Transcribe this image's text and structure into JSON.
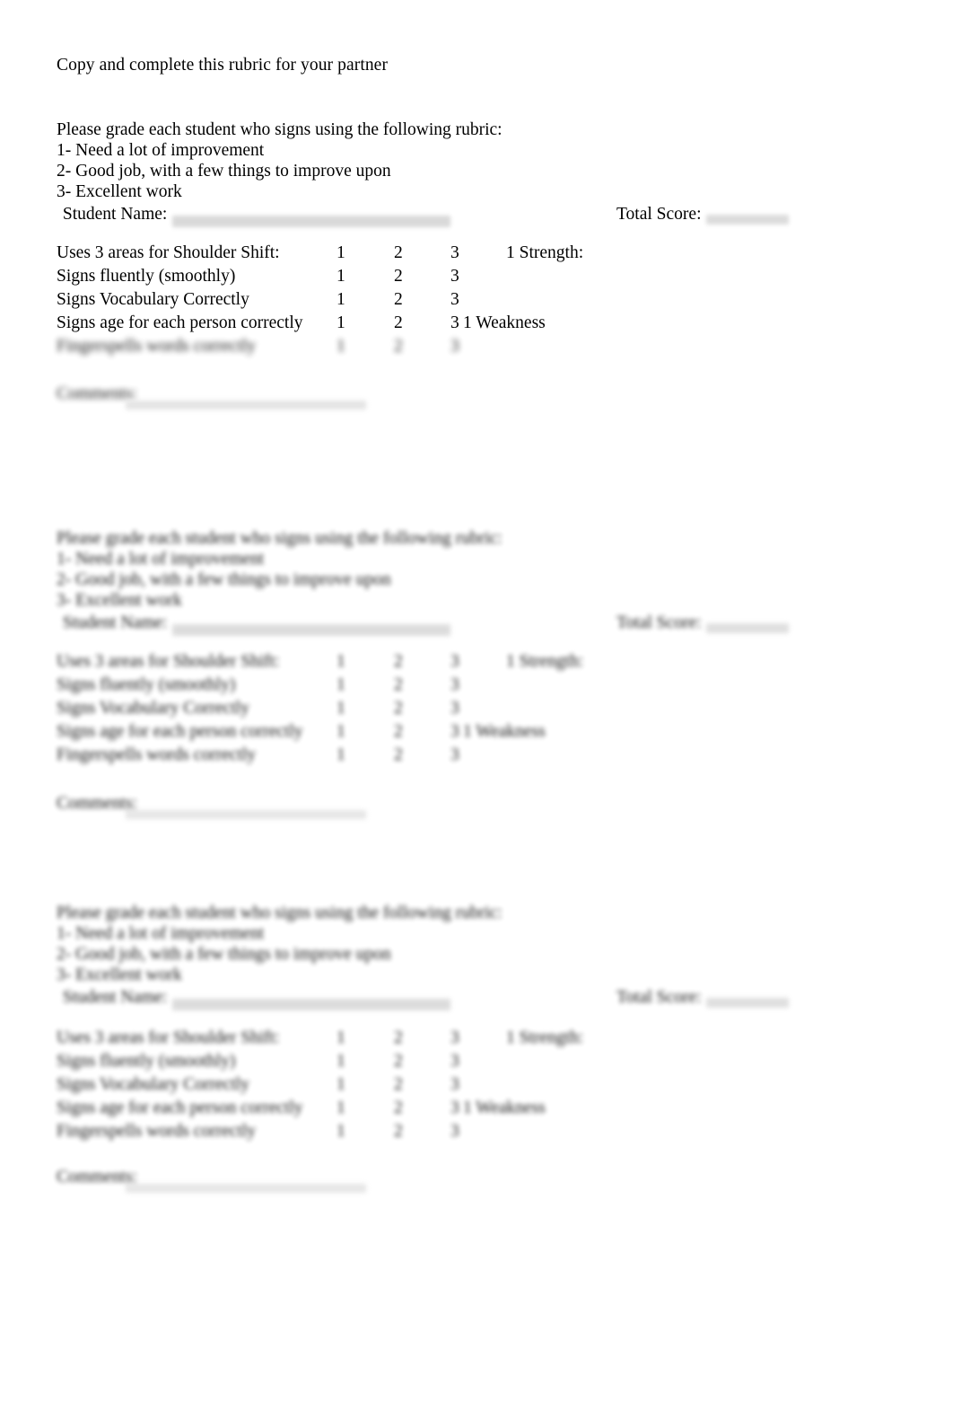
{
  "document": {
    "heading": "Copy and complete this rubric for your partner",
    "background_color": "#ffffff",
    "text_color": "#000000"
  },
  "rubric": {
    "instruction": "Please grade each student who signs using the following rubric:",
    "scale": [
      "1- Need a lot of improvement",
      "2- Good job, with a few things to improve upon",
      "3- Excellent work"
    ],
    "student_name_label": " Student Name:",
    "total_score_label": "Total Score:",
    "comments_label": "Comments:",
    "score_columns": [
      "1",
      "2",
      "3"
    ],
    "criteria": [
      {
        "label": "Uses 3 areas for Shoulder Shift:",
        "scores": [
          "1",
          "2",
          "3"
        ],
        "note": "1 Strength:",
        "note_position": "strength"
      },
      {
        "label": "Signs fluently (smoothly)",
        "scores": [
          "1",
          "2",
          "3"
        ],
        "note": "",
        "note_position": "none"
      },
      {
        "label": "Signs Vocabulary Correctly",
        "scores": [
          "1",
          "2",
          "3"
        ],
        "note": "",
        "note_position": "none"
      },
      {
        "label": "Signs age for each person correctly",
        "scores": [
          "1",
          "2",
          "3"
        ],
        "note": "1 Weakness",
        "note_position": "weakness"
      },
      {
        "label": "Fingerspells words correctly",
        "scores": [
          "1",
          "2",
          "3"
        ],
        "note": "",
        "note_position": "none"
      }
    ]
  },
  "copies": [
    {
      "id": "copy-1",
      "legibility": "sharp"
    },
    {
      "id": "copy-2",
      "legibility": "blurred"
    },
    {
      "id": "copy-3",
      "legibility": "blurred"
    }
  ]
}
